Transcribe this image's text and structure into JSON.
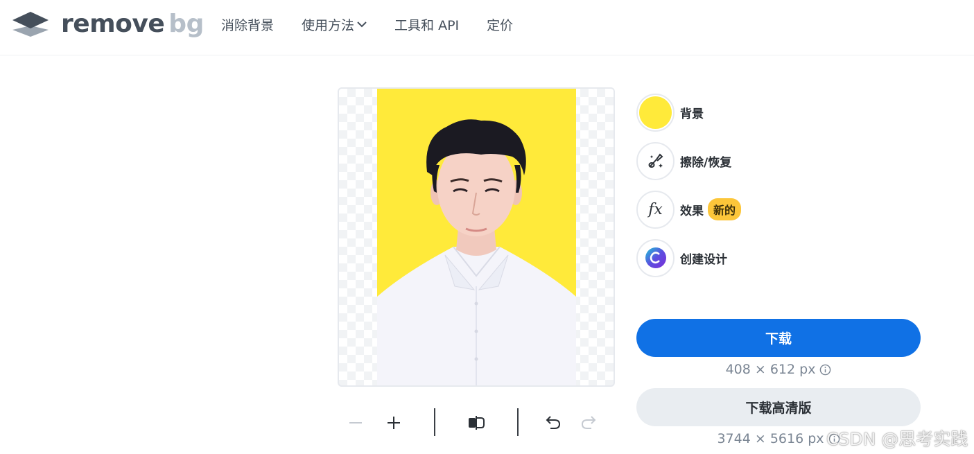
{
  "brand": {
    "word1": "remove",
    "word2": "bg"
  },
  "nav": {
    "items": [
      {
        "label": "消除背景"
      },
      {
        "label": "使用方法"
      },
      {
        "label": "工具和 API"
      },
      {
        "label": "定价"
      }
    ]
  },
  "preview": {
    "background_color": "#ffea3a"
  },
  "tools": [
    {
      "label": "背景",
      "icon": "color-swatch-icon"
    },
    {
      "label": "擦除/恢复",
      "icon": "magic-brush-icon"
    },
    {
      "label": "效果",
      "icon": "fx-icon",
      "badge": "新的"
    },
    {
      "label": "创建设计",
      "icon": "canva-icon"
    }
  ],
  "download": {
    "label": "下载",
    "size": "408 × 612 px"
  },
  "download_hd": {
    "label": "下载高清版",
    "size": "3744 × 5616 px"
  },
  "watermark": "CSDN @思考实践",
  "colors": {
    "primary": "#1071e5",
    "badge": "#fcc63a",
    "swatch": "#ffea3a"
  }
}
